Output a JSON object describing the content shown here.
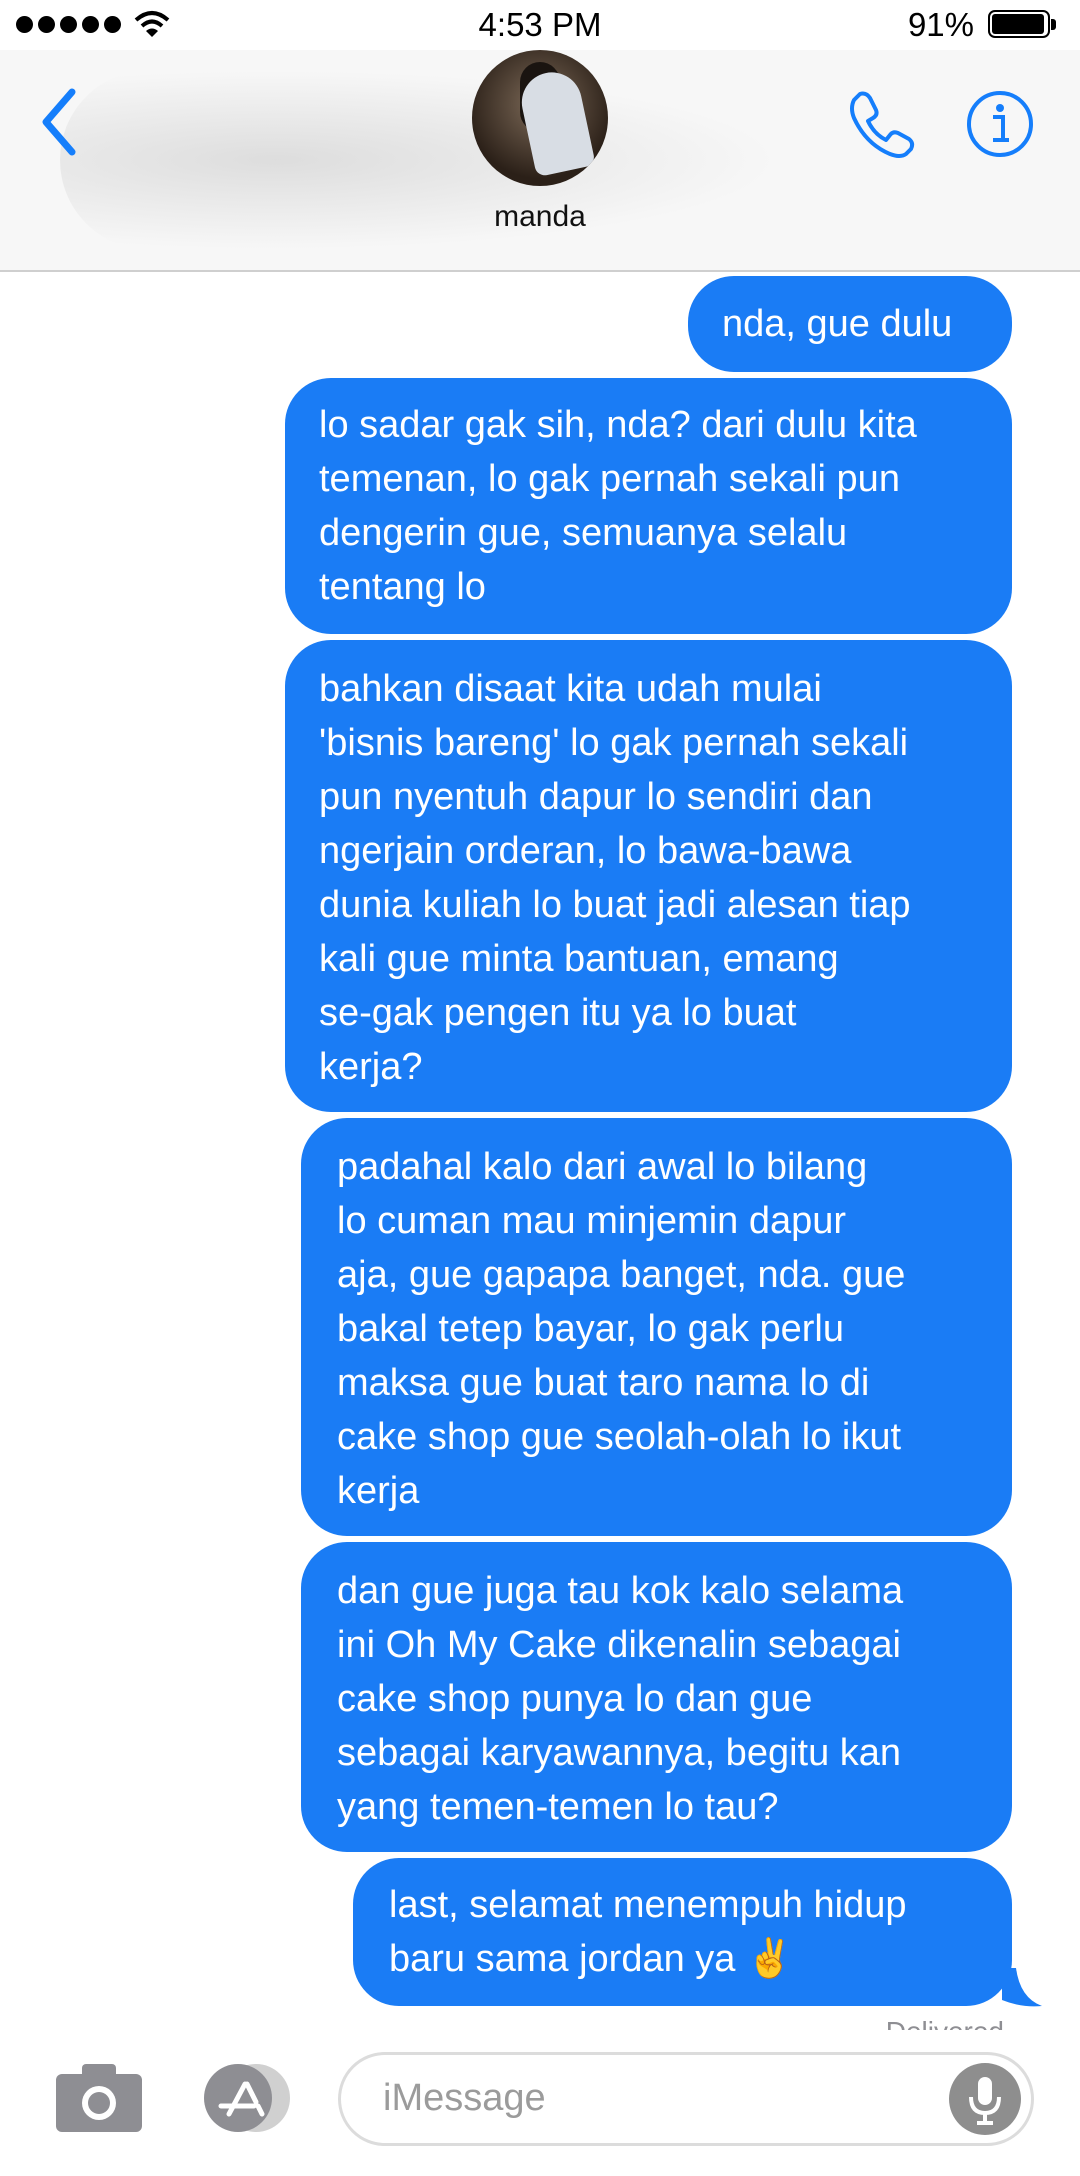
{
  "status_bar": {
    "time": "4:53 PM",
    "battery_percent": "91%",
    "battery_level": 0.91
  },
  "header": {
    "contact_name": "manda"
  },
  "messages": [
    {
      "text": "nda, gue dulu"
    },
    {
      "text": "lo sadar gak sih, nda? dari dulu kita\ntemenan, lo gak pernah sekali pun\ndengerin gue, semuanya selalu\ntentang lo"
    },
    {
      "text": "bahkan disaat kita udah mulai\n'bisnis bareng' lo gak pernah sekali\npun nyentuh dapur lo sendiri dan\nngerjain orderan, lo bawa-bawa\ndunia kuliah lo buat jadi alesan tiap\nkali gue minta bantuan, emang\nse-gak pengen itu ya lo buat\nkerja?"
    },
    {
      "text": "padahal kalo dari awal lo bilang\nlo cuman mau minjemin dapur\naja, gue gapapa banget, nda. gue\nbakal tetep bayar, lo gak perlu\nmaksa gue buat taro nama lo di\ncake shop gue seolah-olah lo ikut\nkerja"
    },
    {
      "text": "dan gue juga tau kok kalo selama\nini Oh My Cake dikenalin sebagai\ncake shop punya lo dan gue\nsebagai karyawannya, begitu kan\nyang temen-temen lo tau?"
    },
    {
      "text": "last, selamat menempuh hidup\nbaru sama jordan ya ✌️"
    }
  ],
  "delivery_status": "Delivered",
  "composer": {
    "placeholder": "iMessage"
  },
  "colors": {
    "bubble": "#1a7cf5",
    "accent": "#157efb"
  },
  "icons": [
    "back-chevron-icon",
    "phone-icon",
    "info-icon",
    "camera-icon",
    "app-store-icon",
    "microphone-icon"
  ]
}
